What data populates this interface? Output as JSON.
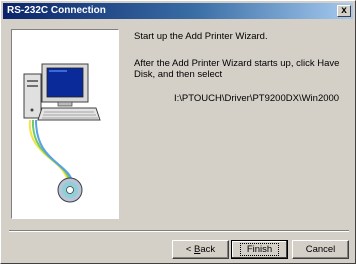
{
  "window": {
    "title": "RS-232C Connection",
    "close_label": "x"
  },
  "content": {
    "instruction_1": "Start up the Add Printer Wizard.",
    "instruction_2": "After the Add Printer Wizard starts up, click Have Disk, and then select",
    "driver_path": "I:\\PTOUCH\\Driver\\PT9200DX\\Win2000"
  },
  "buttons": {
    "back_prefix": "< ",
    "back_accel": "B",
    "back_rest": "ack",
    "finish": "Finish",
    "cancel": "Cancel"
  },
  "colors": {
    "titlebar_start": "#0a246a",
    "titlebar_end": "#a6caf0",
    "dialog_bg": "#d4d0c8",
    "monitor_screen": "#0a2a9a"
  },
  "icons": {
    "illustration": "computer-with-cd-icon"
  }
}
